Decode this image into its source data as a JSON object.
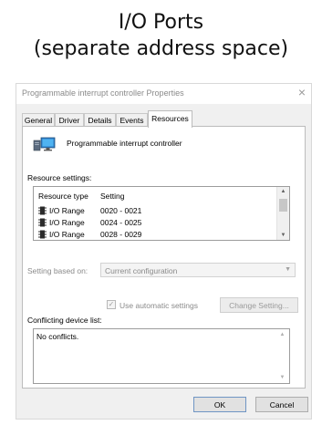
{
  "slide": {
    "title_line1": "I/O Ports",
    "title_line2": "(separate address space)"
  },
  "window": {
    "title": "Programmable interrupt controller Properties",
    "close_glyph": "×"
  },
  "tabs": [
    {
      "label": "General",
      "active": false
    },
    {
      "label": "Driver",
      "active": false
    },
    {
      "label": "Details",
      "active": false
    },
    {
      "label": "Events",
      "active": false
    },
    {
      "label": "Resources",
      "active": true
    }
  ],
  "device": {
    "icon": "computer-monitor-icon",
    "name": "Programmable interrupt controller"
  },
  "resource_settings": {
    "label": "Resource settings:",
    "columns": [
      "Resource type",
      "Setting"
    ],
    "rows": [
      {
        "icon": "memory-chip-icon",
        "type": "I/O Range",
        "setting": "0020 - 0021"
      },
      {
        "icon": "memory-chip-icon",
        "type": "I/O Range",
        "setting": "0024 - 0025"
      },
      {
        "icon": "memory-chip-icon",
        "type": "I/O Range",
        "setting": "0028 - 0029"
      }
    ]
  },
  "setting_based_on": {
    "label": "Setting based on:",
    "value": "Current configuration",
    "enabled": false
  },
  "use_automatic_settings": {
    "label": "Use automatic settings",
    "checked": true,
    "enabled": false
  },
  "change_setting_button": "Change Setting...",
  "conflicts": {
    "label": "Conflicting device list:",
    "value": "No conflicts."
  },
  "buttons": {
    "ok": "OK",
    "cancel": "Cancel"
  },
  "colors": {
    "dialog_background": "#f0f0f0",
    "panel_background": "#ffffff",
    "disabled_text": "#8a8a8a"
  }
}
